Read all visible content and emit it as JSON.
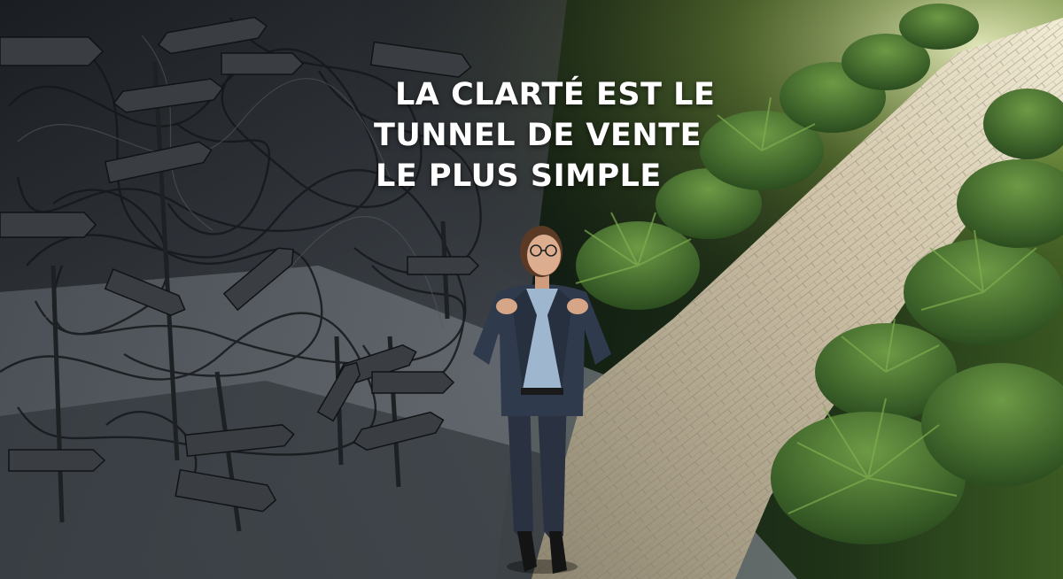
{
  "headline": {
    "line1": "LA CLARTÉ EST LE",
    "line2": "TUNNEL DE VENTE",
    "line3": "LE PLUS SIMPLE"
  },
  "colors": {
    "text": "#ffffff",
    "dark_side": "#3b4045",
    "path": "#cfc3a8",
    "foliage": "#3f6a2a",
    "suit": "#2d3748",
    "shirt": "#9fb6cf"
  }
}
